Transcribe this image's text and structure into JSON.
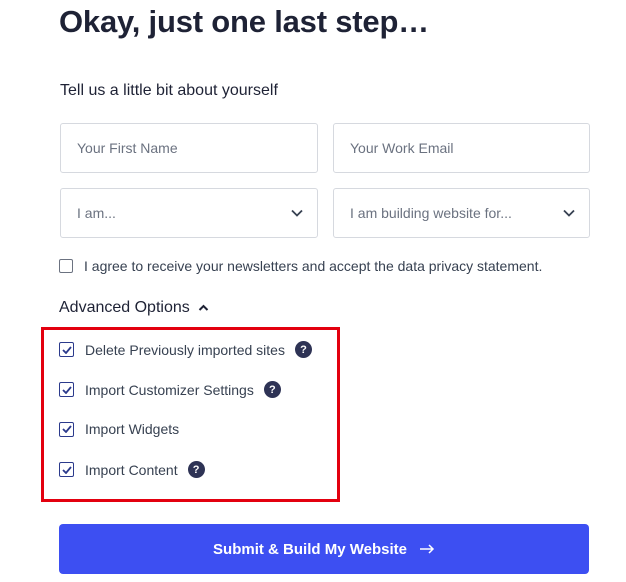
{
  "header": {
    "title": "Okay, just one last step…",
    "subtitle": "Tell us a little bit about yourself"
  },
  "form": {
    "first_name_placeholder": "Your First Name",
    "email_placeholder": "Your Work Email",
    "role_select_value": "I am...",
    "building_select_value": "I am building website for...",
    "consent_label": "I agree to receive your newsletters and accept the data privacy statement.",
    "consent_checked": false
  },
  "advanced": {
    "heading": "Advanced Options",
    "expanded": true,
    "options": [
      {
        "label": "Delete Previously imported sites",
        "checked": true,
        "has_help": true
      },
      {
        "label": "Import Customizer Settings",
        "checked": true,
        "has_help": true
      },
      {
        "label": "Import Widgets",
        "checked": true,
        "has_help": false
      },
      {
        "label": "Import Content",
        "checked": true,
        "has_help": true
      }
    ],
    "help_glyph": "?"
  },
  "submit": {
    "label": "Submit & Build My Website"
  },
  "colors": {
    "accent": "#3d4ff2",
    "highlight": "#e3000f",
    "checkbox": "#2b3a8c",
    "help_badge": "#2e3355"
  }
}
